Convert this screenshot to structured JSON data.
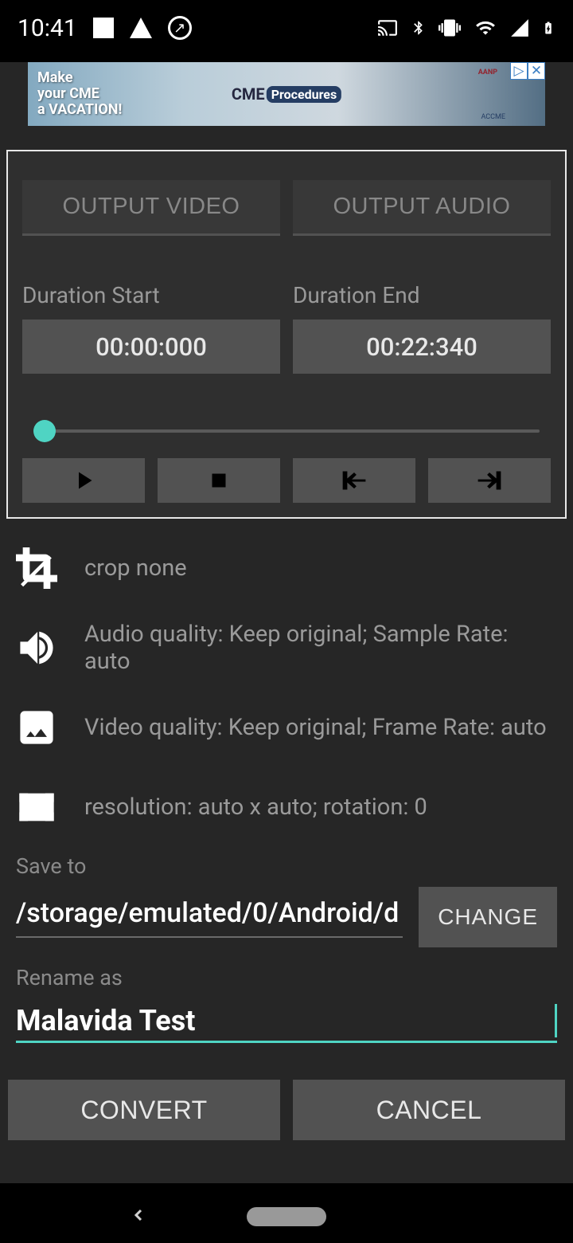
{
  "statusbar": {
    "time": "10:41"
  },
  "ad": {
    "line1": "Make",
    "line2": "your CME",
    "line3": "a VACATION!",
    "brand_left": "CME",
    "brand_right": "Procedures",
    "badge": "AANP",
    "accred": "ACCME"
  },
  "tabs": {
    "video": "OUTPUT VIDEO",
    "audio": "OUTPUT AUDIO"
  },
  "duration": {
    "start_label": "Duration Start",
    "start_value": "00:00:000",
    "end_label": "Duration End",
    "end_value": "00:22:340"
  },
  "slider": {
    "position_percent": 2
  },
  "settings": {
    "crop": "crop none",
    "audio": "Audio quality: Keep original; Sample Rate: auto",
    "video": "Video quality: Keep original; Frame Rate: auto",
    "resolution": "resolution: auto x auto; rotation: 0"
  },
  "form": {
    "save_label": "Save to",
    "save_path": "/storage/emulated/0/Android/d",
    "change_label": "CHANGE",
    "rename_label": "Rename as",
    "rename_value": "Malavida Test"
  },
  "actions": {
    "convert": "CONVERT",
    "cancel": "CANCEL"
  }
}
